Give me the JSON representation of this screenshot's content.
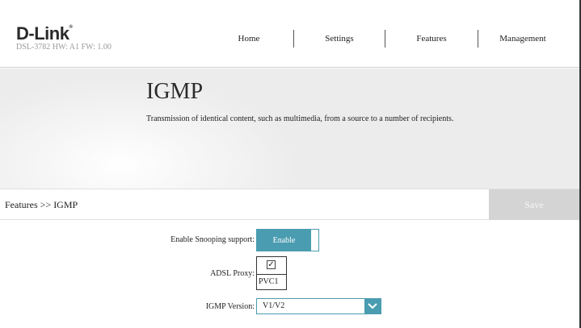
{
  "header": {
    "logo": "D-Link",
    "model_info": "DSL-3782 HW: A1 FW: 1.00",
    "nav": [
      "Home",
      "Settings",
      "Features",
      "Management"
    ]
  },
  "banner": {
    "title": "IGMP",
    "description": "Transmission of identical content, such as multimedia, from a source to a number of recipients."
  },
  "titlebar": {
    "breadcrumb": "Features >> IGMP",
    "save_label": "Save"
  },
  "form": {
    "snooping": {
      "label": "Enable Snooping support:",
      "value": "Enable"
    },
    "adsl_proxy": {
      "label": "ADSL Proxy:",
      "checked": true,
      "option": "PVC1"
    },
    "igmp_version": {
      "label": "IGMP Version:",
      "value": "V1/V2"
    }
  },
  "colors": {
    "accent": "#4a9cb0",
    "save_disabled": "#d4d4d4"
  }
}
